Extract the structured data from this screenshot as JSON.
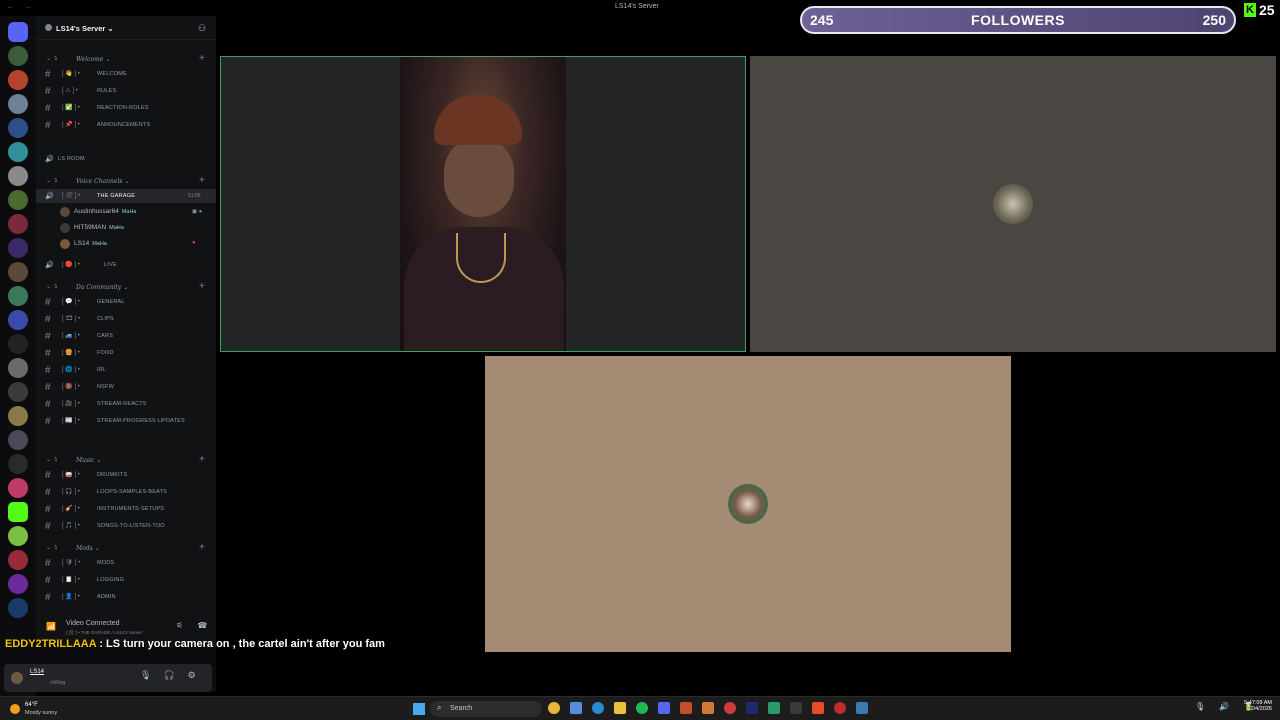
{
  "window": {
    "title": "LS14's Server"
  },
  "goal": {
    "current": "245",
    "label": "FOLLOWERS",
    "target": "250",
    "progress_fraction": 0.98
  },
  "kick_badge": {
    "letter": "K",
    "count": "25"
  },
  "server": {
    "name": "LS14's Server ⌄"
  },
  "channels": [
    {
      "icon": "#",
      "emoji": "[ 👋 ] •",
      "name": "WELCOME"
    },
    {
      "icon": "#",
      "emoji": "[ ⚠ ] •",
      "name": "RULES"
    },
    {
      "icon": "#",
      "emoji": "[ ✅ ] •",
      "name": "REACTION-ROLES"
    },
    {
      "icon": "#",
      "emoji": "[ 📌 ] •",
      "name": "ANNOUNCEMENTS"
    },
    {
      "icon": "🔊",
      "name": "LS ROOM"
    },
    {
      "icon": "🔊",
      "emoji": "[ 🛠 ] •",
      "name": "THE GARAGE",
      "time": "51:06"
    },
    {
      "icon": "🔊",
      "emoji": "[ 🔴 ] •",
      "name": "LIVE"
    },
    {
      "icon": "#",
      "emoji": "[ 💬 ] •",
      "name": "GENERAL"
    },
    {
      "icon": "#",
      "emoji": "[ 🎞 ] •",
      "name": "CLIPS"
    },
    {
      "icon": "#",
      "emoji": "[ 🚙 ] •",
      "name": "CARS"
    },
    {
      "icon": "#",
      "emoji": "[ 🍔 ] •",
      "name": "FOOD"
    },
    {
      "icon": "#",
      "emoji": "[ 🌐 ] •",
      "name": "IRL"
    },
    {
      "icon": "#",
      "emoji": "[ 🔞 ] •",
      "name": "NSFW"
    },
    {
      "icon": "#",
      "emoji": "[ 🎥 ] •",
      "name": "STREAM-REACTS"
    },
    {
      "icon": "#",
      "emoji": "[ 📰 ] •",
      "name": "STREAM-PROGRESS-UPDATES"
    },
    {
      "icon": "#",
      "emoji": "[ 🥁 ] •",
      "name": "DRUMKITS"
    },
    {
      "icon": "#",
      "emoji": "[ 🎧 ] •",
      "name": "LOOPS-SAMPLES-BEATS"
    },
    {
      "icon": "#",
      "emoji": "[ 🎸 ] •",
      "name": "INSTRUMENTS-SETUPS"
    },
    {
      "icon": "#",
      "emoji": "[ 🎵 ] •",
      "name": "SONGS-TO-LISTEN-TOO"
    },
    {
      "icon": "#",
      "emoji": "[ 🛡 ] •",
      "name": "MODS"
    },
    {
      "icon": "#",
      "emoji": "[ 📋 ] •",
      "name": "LOGGING"
    },
    {
      "icon": "#",
      "emoji": "[ 👤 ] •",
      "name": "ADMIN"
    }
  ],
  "categories": {
    "welcome": "Welcome ⌄",
    "voice": "Voice Channels ⌄",
    "community": "Da Community ⌄",
    "music": "Music ⌄",
    "mods": "Mods ⌄"
  },
  "voice_users": [
    {
      "name": "Austinhussar64",
      "tag": "MaHa"
    },
    {
      "name": "HIT59MAN",
      "tag": "MaHa"
    },
    {
      "name": "LS14",
      "tag": "MaHa"
    }
  ],
  "voice_connected": {
    "title": "Video Connected",
    "subtitle": "[ 🛠 ] • THE GARAGE / LS14's Server"
  },
  "user_panel": {
    "username": "LS14",
    "status": "chilling"
  },
  "chat": {
    "user": "EDDY2TRILLAAA",
    "message": " : LS turn your camera on , the cartel ain't after you fam"
  },
  "taskbar": {
    "weather_temp": "64°F",
    "weather_desc": "Mostly sunny",
    "search_placeholder": "Search",
    "time": "5:47:09 AM",
    "date": "2/4/2026"
  },
  "colors": {
    "accent_green": "#3ba55d",
    "goal_fill": "#6e6196",
    "chat_user": "#f1c40f"
  }
}
